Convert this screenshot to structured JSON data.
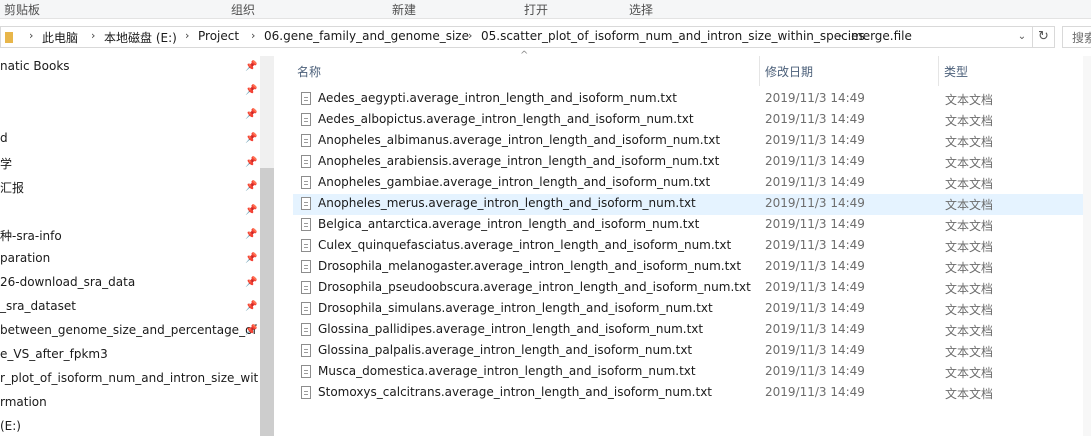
{
  "ribbon": {
    "groups": [
      "剪贴板",
      "组织",
      "新建",
      "打开",
      "选择"
    ]
  },
  "address": {
    "crumbs": [
      "此电脑",
      "本地磁盘 (E:)",
      "Project",
      "06.gene_family_and_genome_size",
      "05.scatter_plot_of_isoform_num_and_intron_size_within_species",
      "merge.file"
    ],
    "search_text": "搜索"
  },
  "nav": {
    "items": [
      {
        "label": "natic Books",
        "pinned": true
      },
      {
        "label": "",
        "pinned": true
      },
      {
        "label": "",
        "pinned": true
      },
      {
        "label": "d",
        "pinned": true
      },
      {
        "label": "学",
        "pinned": true
      },
      {
        "label": "汇报",
        "pinned": true
      },
      {
        "label": "",
        "pinned": true
      },
      {
        "label": "种-sra-info",
        "pinned": true
      },
      {
        "label": "paration",
        "pinned": true
      },
      {
        "label": "26-download_sra_data",
        "pinned": true
      },
      {
        "label": "_sra_dataset",
        "pinned": true
      },
      {
        "label": "between_genome_size_and_percentage_of",
        "pinned": true
      },
      {
        "label": "e_VS_after_fpkm3",
        "pinned": false
      },
      {
        "label": "r_plot_of_isoform_num_and_intron_size_within",
        "pinned": false
      },
      {
        "label": "rmation",
        "pinned": false
      },
      {
        "label": "(E:)",
        "pinned": false
      }
    ]
  },
  "columns": {
    "name": "名称",
    "date": "修改日期",
    "type": "类型"
  },
  "files": [
    {
      "name": "Aedes_aegypti.average_intron_length_and_isoform_num.txt",
      "date": "2019/11/3 14:49",
      "type": "文本文档"
    },
    {
      "name": "Aedes_albopictus.average_intron_length_and_isoform_num.txt",
      "date": "2019/11/3 14:49",
      "type": "文本文档"
    },
    {
      "name": "Anopheles_albimanus.average_intron_length_and_isoform_num.txt",
      "date": "2019/11/3 14:49",
      "type": "文本文档"
    },
    {
      "name": "Anopheles_arabiensis.average_intron_length_and_isoform_num.txt",
      "date": "2019/11/3 14:49",
      "type": "文本文档"
    },
    {
      "name": "Anopheles_gambiae.average_intron_length_and_isoform_num.txt",
      "date": "2019/11/3 14:49",
      "type": "文本文档"
    },
    {
      "name": "Anopheles_merus.average_intron_length_and_isoform_num.txt",
      "date": "2019/11/3 14:49",
      "type": "文本文档",
      "selected": true
    },
    {
      "name": "Belgica_antarctica.average_intron_length_and_isoform_num.txt",
      "date": "2019/11/3 14:49",
      "type": "文本文档"
    },
    {
      "name": "Culex_quinquefasciatus.average_intron_length_and_isoform_num.txt",
      "date": "2019/11/3 14:49",
      "type": "文本文档"
    },
    {
      "name": "Drosophila_melanogaster.average_intron_length_and_isoform_num.txt",
      "date": "2019/11/3 14:49",
      "type": "文本文档"
    },
    {
      "name": "Drosophila_pseudoobscura.average_intron_length_and_isoform_num.txt",
      "date": "2019/11/3 14:49",
      "type": "文本文档"
    },
    {
      "name": "Drosophila_simulans.average_intron_length_and_isoform_num.txt",
      "date": "2019/11/3 14:49",
      "type": "文本文档"
    },
    {
      "name": "Glossina_pallidipes.average_intron_length_and_isoform_num.txt",
      "date": "2019/11/3 14:49",
      "type": "文本文档"
    },
    {
      "name": "Glossina_palpalis.average_intron_length_and_isoform_num.txt",
      "date": "2019/11/3 14:49",
      "type": "文本文档"
    },
    {
      "name": "Musca_domestica.average_intron_length_and_isoform_num.txt",
      "date": "2019/11/3 14:49",
      "type": "文本文档"
    },
    {
      "name": "Stomoxys_calcitrans.average_intron_length_and_isoform_num.txt",
      "date": "2019/11/3 14:49",
      "type": "文本文档"
    }
  ]
}
